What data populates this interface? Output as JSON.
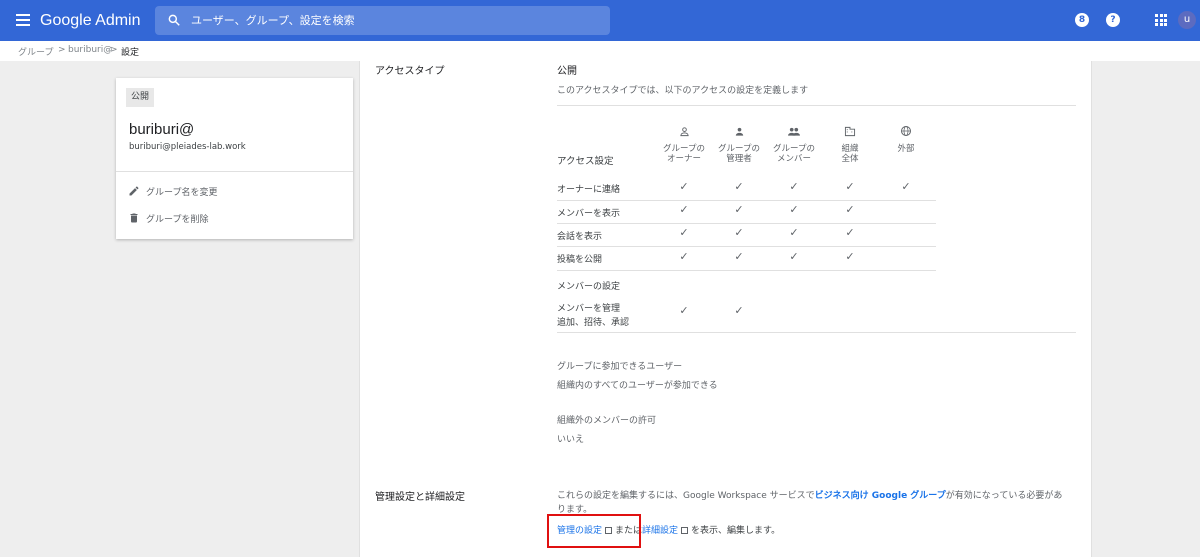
{
  "topbar": {
    "app_title": "Google Admin",
    "search_placeholder": "ユーザー、グループ、設定を検索",
    "support_badge": "8",
    "help_label": "?",
    "avatar_initial": "u"
  },
  "breadcrumb": {
    "items": [
      "グループ",
      "buriburi@",
      "設定"
    ],
    "separator": ">"
  },
  "group_card": {
    "badge": "公開",
    "name": "buriburi@",
    "email": "buriburi@pleiades-lab.work",
    "actions": [
      {
        "label": "グループ名を変更",
        "icon": "pencil-icon"
      },
      {
        "label": "グループを削除",
        "icon": "trash-icon"
      }
    ]
  },
  "access": {
    "section_label": "アクセスタイプ",
    "type_value": "公開",
    "description": "このアクセスタイプでは、以下のアクセスの設定を定義します",
    "settings_label": "アクセス設定",
    "columns": [
      {
        "icon": "person-outline-icon",
        "line1": "グループの",
        "line2": "オーナー"
      },
      {
        "icon": "person-icon",
        "line1": "グループの",
        "line2": "管理者"
      },
      {
        "icon": "people-icon",
        "line1": "グループの",
        "line2": "メンバー"
      },
      {
        "icon": "building-icon",
        "line1": "組織",
        "line2": "全体"
      },
      {
        "icon": "globe-icon",
        "line1": "外部",
        "line2": ""
      }
    ],
    "rows": [
      {
        "label": "オーナーに連絡",
        "checks": [
          true,
          true,
          true,
          true,
          true
        ]
      },
      {
        "label": "メンバーを表示",
        "checks": [
          true,
          true,
          true,
          true,
          false
        ]
      },
      {
        "label": "会話を表示",
        "checks": [
          true,
          true,
          true,
          true,
          false
        ]
      },
      {
        "label": "投稿を公開",
        "checks": [
          true,
          true,
          true,
          true,
          false
        ]
      }
    ],
    "member_settings_label": "メンバーの設定",
    "manage_members": {
      "line1": "メンバーを管理",
      "line2": "追加、招待、承認",
      "checks": [
        true,
        true,
        false,
        false,
        false
      ]
    },
    "check_glyph": "✓",
    "who_can_join_label": "グループに参加できるユーザー",
    "who_can_join_value": "組織内のすべてのユーザーが参加できる",
    "external_members_label": "組織外のメンバーの許可",
    "external_members_value": "いいえ"
  },
  "advanced": {
    "section_label": "管理設定と詳細設定",
    "desc_prefix": "これらの設定を編集するには、Google Workspace サービスで",
    "desc_link": "ビジネス向け Google グループ",
    "desc_suffix": "が有効になっている必要があ",
    "desc_line2": "ります。",
    "admin_link": "管理の設定",
    "or_text": "または",
    "advanced_link": "詳細設定",
    "tail_text": "を表示、編集します。"
  },
  "colors": {
    "topbar": "#3367d6",
    "link": "#1a73e8",
    "highlight": "#e01010"
  }
}
